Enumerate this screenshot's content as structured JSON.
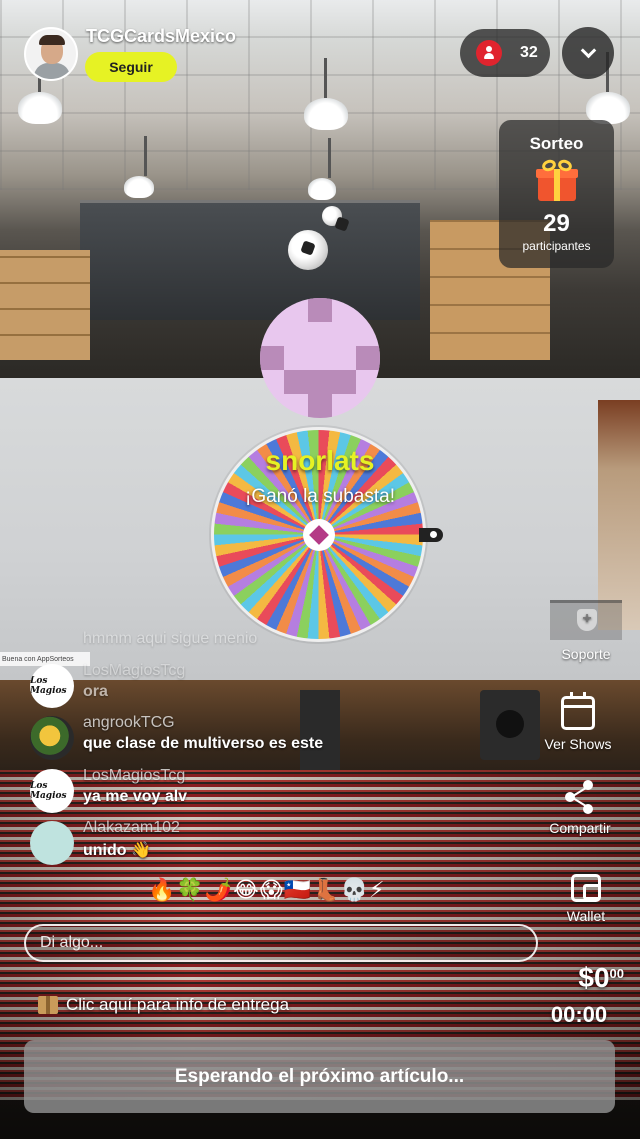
{
  "header": {
    "streamer_name": "TCGCardsMexico",
    "follow_label": "Seguir",
    "viewer_count": "32"
  },
  "raffle": {
    "title": "Sorteo",
    "count": "29",
    "label": "participantes"
  },
  "wheel": {
    "winner_name": "snorlats",
    "message": "¡Ganó la subasta!"
  },
  "chat": {
    "faded_message": "hmmm aqui sigue menio",
    "tiny_banner": "Buena con AppSorteos",
    "messages": [
      {
        "user": "LosMagiosTcg",
        "text": "ora",
        "avatar_label": "Los Magios"
      },
      {
        "user": "angrookTCG",
        "text": "que clase de multiverso es este",
        "avatar_label": ""
      },
      {
        "user": "LosMagiosTcg",
        "text": "ya me voy alv",
        "avatar_label": "Los Magios"
      },
      {
        "user": "Alakazam102",
        "text": "unido 👋",
        "avatar_label": ""
      }
    ]
  },
  "rail": {
    "support": "Soporte",
    "shows": "Ver Shows",
    "share": "Compartir",
    "wallet": "Wallet"
  },
  "bottom": {
    "emojis": "🔥🍀🌶️😂😱🇨🇱👢💀⚡",
    "input_placeholder": "Di algo...",
    "price_main": "$0",
    "price_cents": "00",
    "timer": "00:00",
    "delivery_info": "Clic aquí para info de entrega",
    "cta_label": "Esperando el próximo artículo..."
  },
  "colors": {
    "accent_yellow": "#e6f224",
    "viewer_red": "#e0242e"
  },
  "icons": [
    "viewer-icon",
    "chevron-down-icon",
    "gift-icon",
    "support-icon",
    "calendar-icon",
    "share-icon",
    "wallet-icon",
    "package-icon"
  ]
}
